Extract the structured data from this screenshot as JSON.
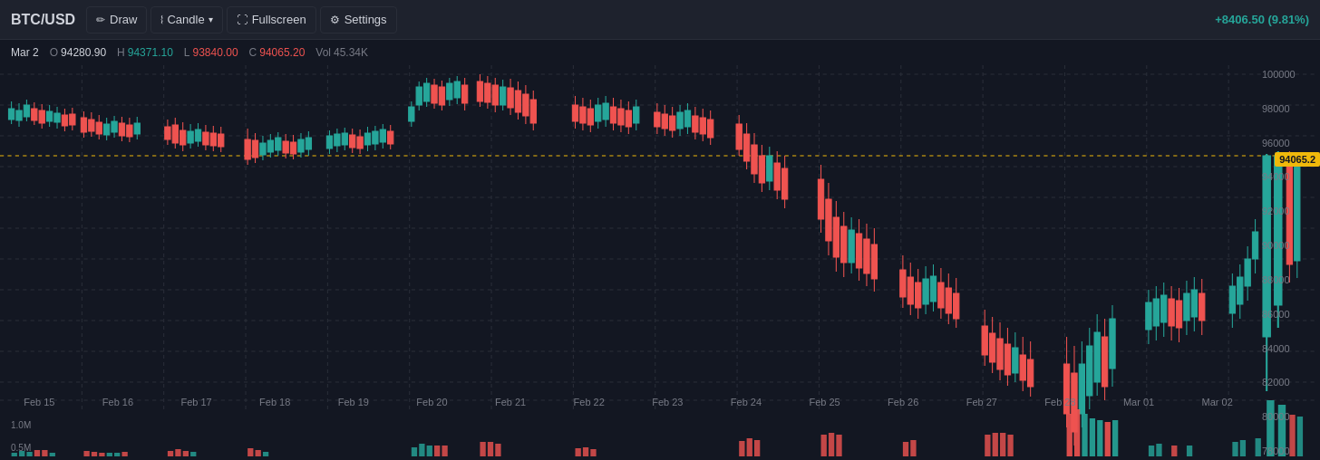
{
  "toolbar": {
    "pair": "BTC/USD",
    "draw_label": "Draw",
    "candle_label": "Candle",
    "fullscreen_label": "Fullscreen",
    "settings_label": "Settings",
    "change": "+8406.50 (9.81%)"
  },
  "ohlcv": {
    "date": "Mar 2",
    "open_label": "O",
    "open_value": "94280.90",
    "high_label": "H",
    "high_value": "94371.10",
    "low_label": "L",
    "low_value": "93840.00",
    "close_label": "C",
    "close_value": "94065.20",
    "vol_label": "Vol",
    "vol_value": "45.34K"
  },
  "price_label": "94065.2",
  "y_axis": {
    "labels": [
      "100000",
      "98000",
      "96000",
      "94000",
      "92000",
      "90000",
      "88000",
      "86000",
      "84000",
      "82000",
      "80000",
      "78000"
    ]
  },
  "x_axis": {
    "labels": [
      "Feb 15",
      "Feb 16",
      "Feb 17",
      "Feb 18",
      "Feb 19",
      "Feb 20",
      "Feb 21",
      "Feb 22",
      "Feb 23",
      "Feb 24",
      "Feb 25",
      "Feb 26",
      "Feb 27",
      "Feb 28",
      "Mar 01",
      "Mar 02"
    ]
  },
  "vol_levels": {
    "top": "1.0M",
    "mid": "0.5M"
  },
  "colors": {
    "up": "#26a69a",
    "down": "#ef5350",
    "bg": "#131722",
    "grid": "#2a2e39",
    "price_label_bg": "#f0b90b",
    "price_label_text": "#131722"
  }
}
